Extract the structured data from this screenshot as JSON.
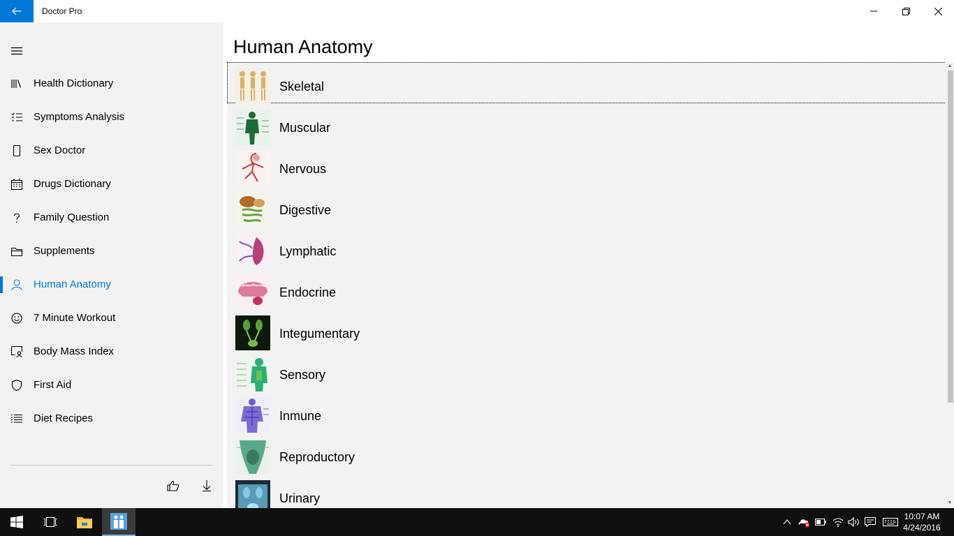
{
  "window": {
    "title": "Doctor Pro",
    "accent": "#0078d7"
  },
  "sidebar": {
    "items": [
      {
        "label": "Health Dictionary",
        "icon": "books-icon"
      },
      {
        "label": "Symptoms Analysis",
        "icon": "checklist-icon"
      },
      {
        "label": "Sex Doctor",
        "icon": "phone-icon"
      },
      {
        "label": "Drugs Dictionary",
        "icon": "calendar-icon"
      },
      {
        "label": "Family Question",
        "icon": "question-icon"
      },
      {
        "label": "Supplements",
        "icon": "folder-icon"
      },
      {
        "label": "Human Anatomy",
        "icon": "person-icon",
        "active": true
      },
      {
        "label": "7 Minute Workout",
        "icon": "smiley-icon"
      },
      {
        "label": "Body Mass Index",
        "icon": "contact-card-icon"
      },
      {
        "label": "First Aid",
        "icon": "shield-icon"
      },
      {
        "label": "Diet Recipes",
        "icon": "list-icon"
      }
    ],
    "footer_buttons": [
      "thumbs-up-icon",
      "download-icon"
    ]
  },
  "main": {
    "title": "Human Anatomy",
    "items": [
      {
        "label": "Skeletal",
        "selected": true
      },
      {
        "label": "Muscular"
      },
      {
        "label": "Nervous"
      },
      {
        "label": "Digestive"
      },
      {
        "label": "Lymphatic"
      },
      {
        "label": "Endocrine"
      },
      {
        "label": "Integumentary"
      },
      {
        "label": "Sensory"
      },
      {
        "label": "Inmune"
      },
      {
        "label": "Reproductory"
      },
      {
        "label": "Urinary"
      }
    ]
  },
  "taskbar": {
    "time": "10:07 AM",
    "date": "4/24/2016"
  }
}
